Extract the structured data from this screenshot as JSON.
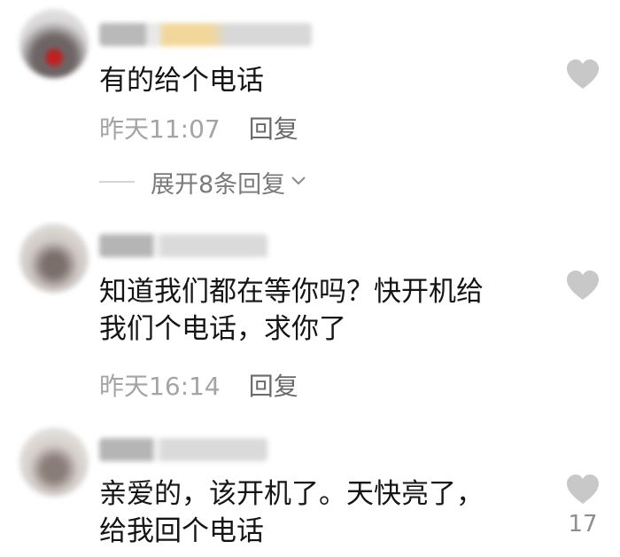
{
  "comments": [
    {
      "text": "有的给个电话",
      "time": "昨天11:07",
      "reply_label": "回复",
      "expand_label": "展开8条回复",
      "like_count": ""
    },
    {
      "text_line1": "知道我们都在等你吗？快开机给",
      "text_line2": "我们个电话，求你了",
      "time": "昨天16:14",
      "reply_label": "回复",
      "like_count": ""
    },
    {
      "text_line1": "亲爱的，该开机了。天快亮了，",
      "text_line2": "给我回个电话",
      "like_count": "17"
    }
  ],
  "icons": {
    "like": "heart-icon",
    "expand": "chevron-down-icon"
  },
  "colors": {
    "heart": "#c8c8c8",
    "meta": "#a4a4a4",
    "text": "#151515"
  }
}
